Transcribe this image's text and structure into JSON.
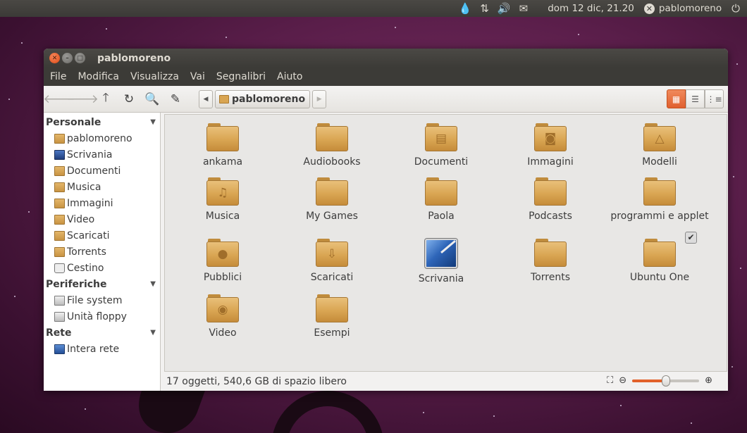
{
  "top_panel": {
    "datetime": "dom 12 dic, 21.20",
    "user": "pablomoreno",
    "icons": [
      "droplet-icon",
      "network-icon",
      "volume-icon",
      "mail-icon",
      "session-close-icon",
      "power-icon"
    ]
  },
  "window": {
    "title": "pablomoreno",
    "menu": [
      "File",
      "Modifica",
      "Visualizza",
      "Vai",
      "Segnalibri",
      "Aiuto"
    ],
    "path": {
      "current": "pablomoreno"
    },
    "view_mode": "icons"
  },
  "sidebar": {
    "sections": [
      {
        "title": "Personale",
        "items": [
          {
            "label": "pablomoreno",
            "icon": "home-folder-icon"
          },
          {
            "label": "Scrivania",
            "icon": "desktop-icon"
          },
          {
            "label": "Documenti",
            "icon": "documents-folder-icon"
          },
          {
            "label": "Musica",
            "icon": "music-folder-icon"
          },
          {
            "label": "Immagini",
            "icon": "pictures-folder-icon"
          },
          {
            "label": "Video",
            "icon": "videos-folder-icon"
          },
          {
            "label": "Scaricati",
            "icon": "downloads-folder-icon"
          },
          {
            "label": "Torrents",
            "icon": "folder-icon"
          },
          {
            "label": "Cestino",
            "icon": "trash-icon"
          }
        ]
      },
      {
        "title": "Periferiche",
        "items": [
          {
            "label": "File system",
            "icon": "drive-icon"
          },
          {
            "label": "Unità floppy",
            "icon": "floppy-icon"
          }
        ]
      },
      {
        "title": "Rete",
        "items": [
          {
            "label": "Intera rete",
            "icon": "network-icon"
          }
        ]
      }
    ]
  },
  "files": [
    {
      "name": "ankama",
      "icon": "folder-icon",
      "glyph": ""
    },
    {
      "name": "Audiobooks",
      "icon": "folder-icon",
      "glyph": ""
    },
    {
      "name": "Documenti",
      "icon": "documents-folder-icon",
      "glyph": "▤"
    },
    {
      "name": "Immagini",
      "icon": "pictures-folder-icon",
      "glyph": "◙"
    },
    {
      "name": "Modelli",
      "icon": "templates-folder-icon",
      "glyph": "△"
    },
    {
      "name": "Musica",
      "icon": "music-folder-icon",
      "glyph": "♫"
    },
    {
      "name": "My Games",
      "icon": "folder-icon",
      "glyph": ""
    },
    {
      "name": "Paola",
      "icon": "folder-icon",
      "glyph": ""
    },
    {
      "name": "Podcasts",
      "icon": "folder-icon",
      "glyph": ""
    },
    {
      "name": "programmi e applet",
      "icon": "folder-icon",
      "glyph": ""
    },
    {
      "name": "Pubblici",
      "icon": "public-folder-icon",
      "glyph": "●"
    },
    {
      "name": "Scaricati",
      "icon": "downloads-folder-icon",
      "glyph": "⇩"
    },
    {
      "name": "Scrivania",
      "icon": "desktop-icon",
      "glyph": ""
    },
    {
      "name": "Torrents",
      "icon": "folder-icon",
      "glyph": ""
    },
    {
      "name": "Ubuntu One",
      "icon": "ubuntu-one-folder-icon",
      "glyph": "",
      "emblem": "✔"
    },
    {
      "name": "Video",
      "icon": "videos-folder-icon",
      "glyph": "◉"
    },
    {
      "name": "Esempi",
      "icon": "folder-icon",
      "glyph": ""
    }
  ],
  "status": {
    "text": "17 oggetti, 540,6 GB di spazio libero",
    "zoom_level": 0.5
  }
}
